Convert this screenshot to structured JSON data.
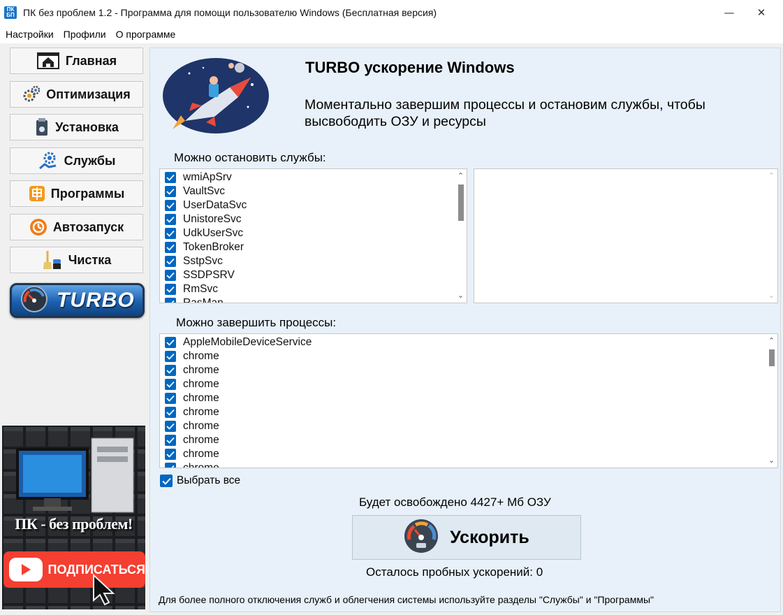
{
  "window": {
    "app_icon_line1": "ПК",
    "app_icon_line2": "БП",
    "title": "ПК без проблем 1.2 - Программа для помощи пользователю Windows (Бесплатная версия)",
    "minimize_glyph": "—",
    "maximize_glyph": "☐",
    "close_glyph": "✕"
  },
  "menu": {
    "items": [
      "Настройки",
      "Профили",
      "О программе"
    ]
  },
  "sidebar": {
    "items": [
      {
        "label": "Главная",
        "icon": "home-icon"
      },
      {
        "label": "Оптимизация",
        "icon": "gears-icon"
      },
      {
        "label": "Установка",
        "icon": "installer-icon"
      },
      {
        "label": "Службы",
        "icon": "services-icon"
      },
      {
        "label": "Программы",
        "icon": "programs-icon"
      },
      {
        "label": "Автозапуск",
        "icon": "autostart-icon"
      },
      {
        "label": "Чистка",
        "icon": "broom-icon"
      }
    ],
    "turbo_label": "TURBO",
    "ad_text": "ПК - без проблем!",
    "ad_subscribe": "ПОДПИСАТЬСЯ"
  },
  "main": {
    "heading": "TURBO ускорение Windows",
    "description": "Моментально завершим процессы и остановим службы, чтобы высвободить ОЗУ и ресурсы",
    "services_caption": "Можно остановить службы:",
    "services": [
      "wmiApSrv",
      "VaultSvc",
      "UserDataSvc",
      "UnistoreSvc",
      "UdkUserSvc",
      "TokenBroker",
      "SstpSvc",
      "SSDPSRV",
      "RmSvc",
      "RasMan"
    ],
    "processes_caption": "Можно завершить процессы:",
    "processes": [
      "AppleMobileDeviceService",
      "chrome",
      "chrome",
      "chrome",
      "chrome",
      "chrome",
      "chrome",
      "chrome",
      "chrome",
      "chrome"
    ],
    "select_all_label": "Выбрать все",
    "free_memory_text": "Будет освобождено 4427+ Мб ОЗУ",
    "speedup_label": "Ускорить",
    "remaining_text": "Осталось пробных ускорений: 0",
    "footer_text": "Для более полного отключения служб и облегчения системы используйте разделы \"Службы\" и \"Программы\""
  },
  "colors": {
    "accent": "#0067c0",
    "panel_bg": "#e8f1f9",
    "client_bg": "#f0f0f0"
  }
}
